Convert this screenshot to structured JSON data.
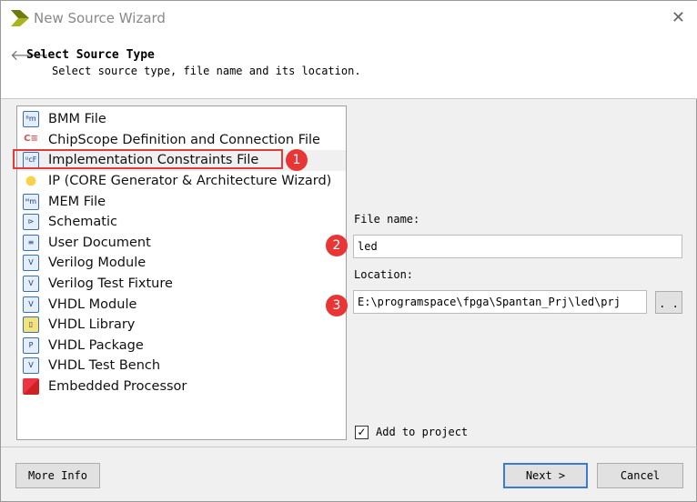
{
  "window": {
    "title": "New Source Wizard",
    "close_icon": "close-icon"
  },
  "header": {
    "title": "Select Source Type",
    "subtitle": "Select source type, file name and its location."
  },
  "source_types": [
    {
      "label": "BMM File",
      "icon": "bmm-file-icon"
    },
    {
      "label": "ChipScope Definition and Connection File",
      "icon": "chipscope-icon"
    },
    {
      "label": "Implementation Constraints File",
      "icon": "ucf-file-icon",
      "selected": true
    },
    {
      "label": "IP (CORE Generator & Architecture Wizard)",
      "icon": "ip-core-icon"
    },
    {
      "label": "MEM File",
      "icon": "mem-file-icon"
    },
    {
      "label": "Schematic",
      "icon": "schematic-icon"
    },
    {
      "label": "User Document",
      "icon": "document-icon"
    },
    {
      "label": "Verilog Module",
      "icon": "verilog-module-icon"
    },
    {
      "label": "Verilog Test Fixture",
      "icon": "verilog-test-icon"
    },
    {
      "label": "VHDL Module",
      "icon": "vhdl-module-icon"
    },
    {
      "label": "VHDL Library",
      "icon": "vhdl-library-icon"
    },
    {
      "label": "VHDL Package",
      "icon": "vhdl-package-icon"
    },
    {
      "label": "VHDL Test Bench",
      "icon": "vhdl-testbench-icon"
    },
    {
      "label": "Embedded Processor",
      "icon": "embedded-processor-icon"
    }
  ],
  "form": {
    "file_name_label": "File name:",
    "file_name": "led",
    "location_label": "Location:",
    "location": "E:\\programspace\\fpga\\Spantan_Prj\\led\\prj",
    "browse_label": ". .",
    "add_to_project_label": "Add to project",
    "add_to_project": true
  },
  "annotations": [
    "1",
    "2",
    "3"
  ],
  "buttons": {
    "more_info": "More Info",
    "next": "Next >",
    "cancel": "Cancel"
  },
  "colors": {
    "highlight": "#e23b3b",
    "default_button_border": "#3b7bd4"
  }
}
